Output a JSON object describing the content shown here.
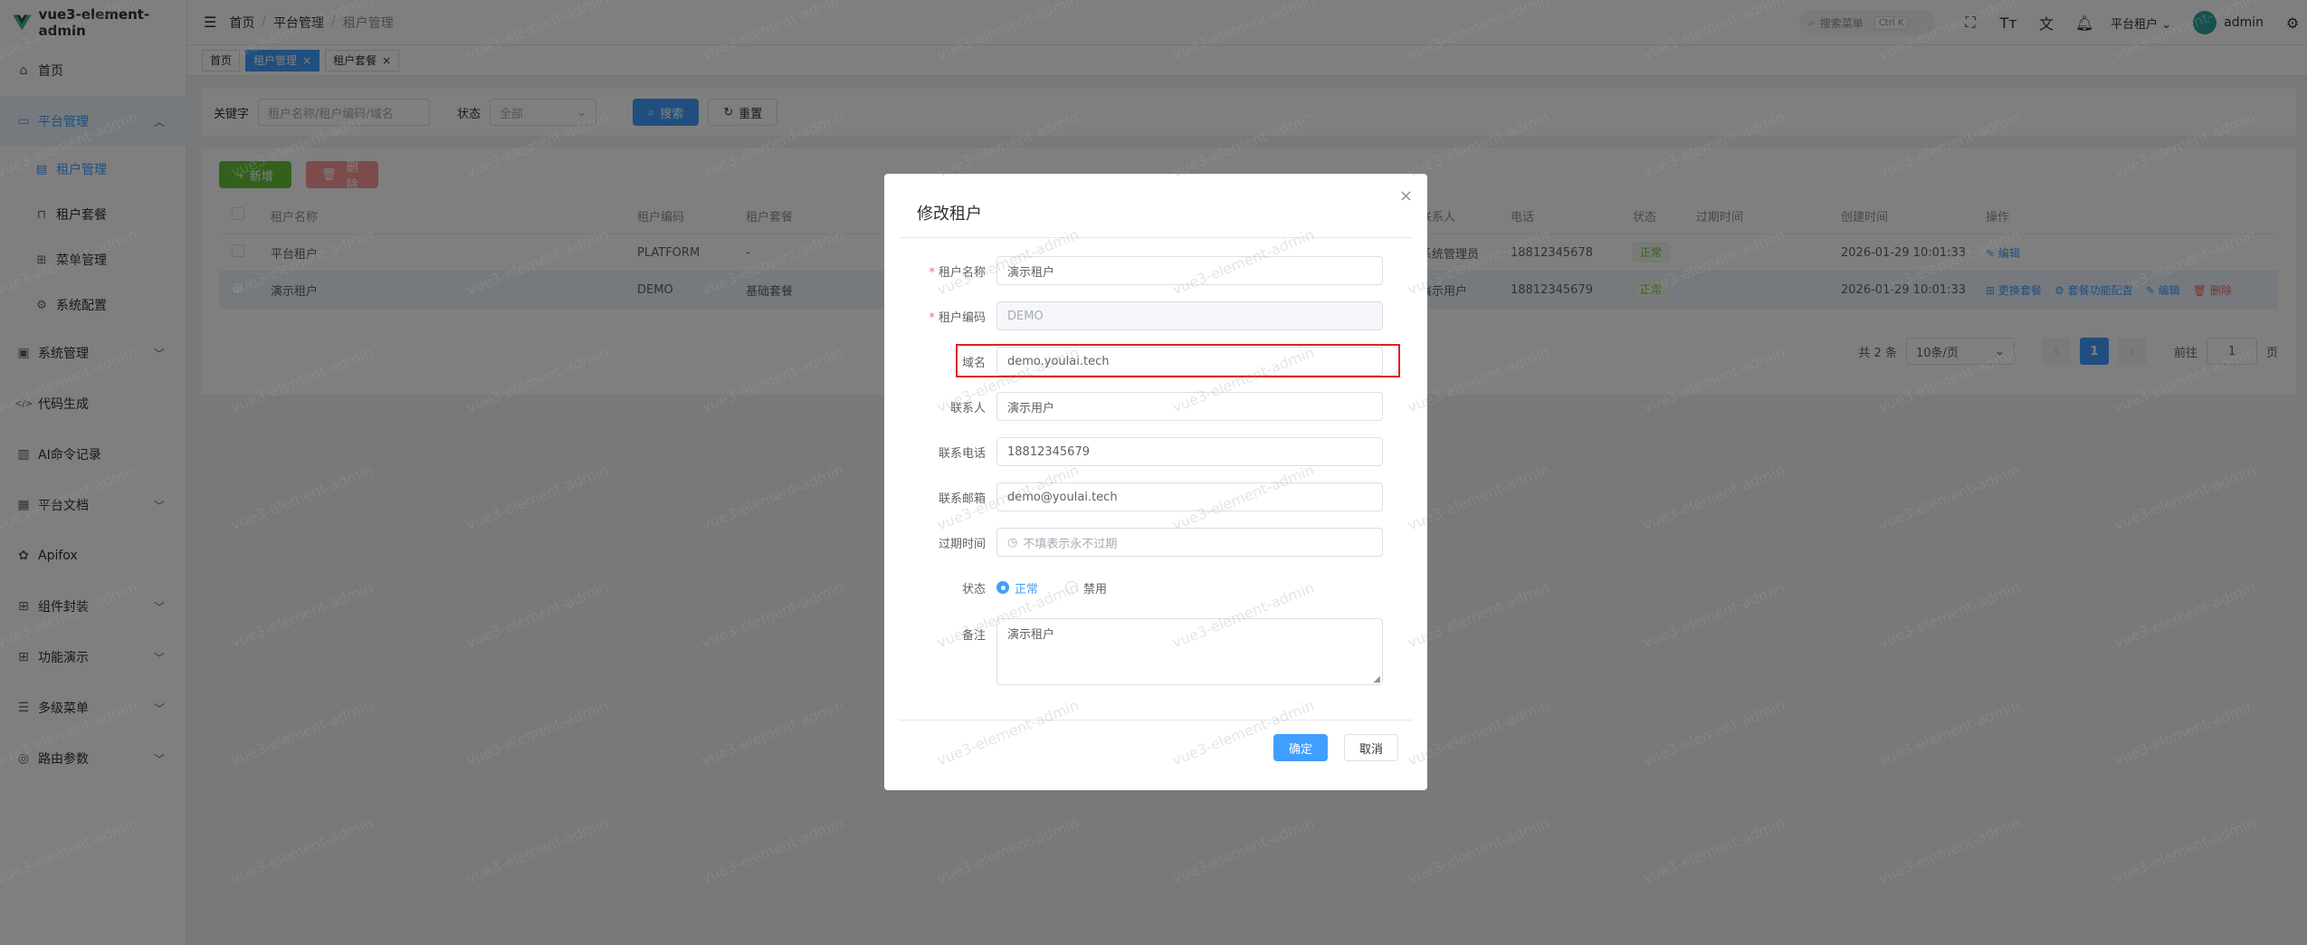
{
  "app": {
    "title": "vue3-element-admin"
  },
  "sidebar": {
    "items": [
      {
        "label": "首页",
        "icon": "home-icon"
      },
      {
        "label": "平台管理",
        "icon": "monitor-icon",
        "open": true,
        "children": [
          {
            "label": "租户管理",
            "icon": "document-icon",
            "active": true
          },
          {
            "label": "租户套餐",
            "icon": "bookmark-icon"
          },
          {
            "label": "菜单管理",
            "icon": "grid-icon"
          },
          {
            "label": "系统配置",
            "icon": "gear-icon"
          }
        ]
      },
      {
        "label": "系统管理",
        "icon": "system-icon",
        "expandable": true
      },
      {
        "label": "代码生成",
        "icon": "code-icon"
      },
      {
        "label": "AI命令记录",
        "icon": "clipboard-icon"
      },
      {
        "label": "平台文档",
        "icon": "doc-icon",
        "expandable": true
      },
      {
        "label": "Apifox",
        "icon": "apifox-icon"
      },
      {
        "label": "组件封装",
        "icon": "grid-icon",
        "expandable": true
      },
      {
        "label": "功能演示",
        "icon": "grid-icon",
        "expandable": true
      },
      {
        "label": "多级菜单",
        "icon": "tree-icon",
        "expandable": true
      },
      {
        "label": "路由参数",
        "icon": "route-icon",
        "expandable": true
      }
    ]
  },
  "header": {
    "breadcrumb": [
      "首页",
      "平台管理",
      "租户管理"
    ],
    "search_placeholder": "搜索菜单",
    "search_shortcut": "Ctrl K",
    "tenant_label": "平台租户",
    "username": "admin"
  },
  "tags": [
    {
      "label": "首页",
      "active": false,
      "closable": false
    },
    {
      "label": "租户管理",
      "active": true,
      "closable": true
    },
    {
      "label": "租户套餐",
      "active": false,
      "closable": true
    }
  ],
  "filter": {
    "keyword_label": "关键字",
    "keyword_placeholder": "租户名称/租户编码/域名",
    "status_label": "状态",
    "status_placeholder": "全部",
    "search_button": "搜索",
    "reset_button": "重置"
  },
  "toolbar": {
    "add_button": "新增",
    "delete_button": "删除"
  },
  "table": {
    "columns": [
      "租户名称",
      "租户编码",
      "租户套餐",
      "联系人",
      "电话",
      "状态",
      "过期时间",
      "创建时间",
      "操作"
    ],
    "rows": [
      {
        "name": "平台租户",
        "code": "PLATFORM",
        "plan": "-",
        "contact": "系统管理员",
        "phone": "18812345678",
        "status": "正常",
        "expire": "",
        "created": "2026-01-29 10:01:33",
        "actions": [
          "编辑"
        ]
      },
      {
        "name": "演示租户",
        "code": "DEMO",
        "plan": "基础套餐",
        "contact": "演示用户",
        "phone": "18812345679",
        "status": "正常",
        "expire": "",
        "created": "2026-01-29 10:01:33",
        "actions": [
          "更换套餐",
          "套餐功能配置",
          "编辑",
          "删除"
        ]
      }
    ]
  },
  "pagination": {
    "total_text": "共 2 条",
    "page_size": "10条/页",
    "current_page": "1",
    "goto_label": "前往",
    "goto_value": "1",
    "page_suffix": "页"
  },
  "dialog": {
    "title": "修改租户",
    "fields": {
      "name": {
        "label": "租户名称",
        "value": "演示租户",
        "required": true
      },
      "code": {
        "label": "租户编码",
        "value": "DEMO",
        "required": true,
        "disabled": true
      },
      "domain": {
        "label": "域名",
        "value": "demo.youlai.tech"
      },
      "contact": {
        "label": "联系人",
        "value": "演示用户"
      },
      "phone": {
        "label": "联系电话",
        "value": "18812345679"
      },
      "email": {
        "label": "联系邮箱",
        "value": "demo@youlai.tech"
      },
      "expire": {
        "label": "过期时间",
        "placeholder": "不填表示永不过期"
      },
      "status": {
        "label": "状态",
        "options": [
          "正常",
          "禁用"
        ],
        "selected": "正常"
      },
      "remark": {
        "label": "备注",
        "value": "演示租户"
      }
    },
    "confirm_button": "确定",
    "cancel_button": "取消"
  },
  "watermark": "vue3-element-admin",
  "colors": {
    "primary": "#409eff",
    "success": "#67c23a",
    "danger": "#f56c6c",
    "highlight": "#e02020"
  }
}
